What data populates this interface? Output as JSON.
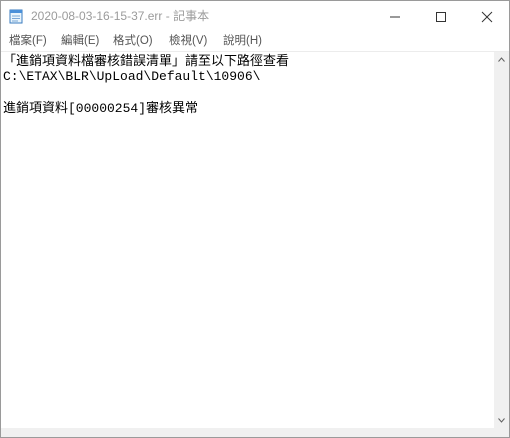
{
  "window": {
    "title": "2020-08-03-16-15-37.err - 記事本",
    "icon": "notepad-icon",
    "controls": {
      "minimize_icon": "minimize-icon",
      "maximize_icon": "maximize-icon",
      "close_icon": "close-icon"
    }
  },
  "menubar": {
    "items": [
      {
        "label": "檔案(F)"
      },
      {
        "label": "編輯(E)"
      },
      {
        "label": "格式(O)"
      },
      {
        "label": "檢視(V)"
      },
      {
        "label": "說明(H)"
      }
    ]
  },
  "editor": {
    "lines": [
      "「進銷項資料檔審核錯誤清單」請至以下路徑查看",
      "C:\\ETAX\\BLR\\UpLoad\\Default\\10906\\",
      "",
      "進銷項資料[00000254]審核異常"
    ]
  },
  "colors": {
    "title_text": "#9b9b9b",
    "menu_text": "#555555",
    "editor_text": "#000000",
    "scrollbar": "#f0f0f0"
  }
}
